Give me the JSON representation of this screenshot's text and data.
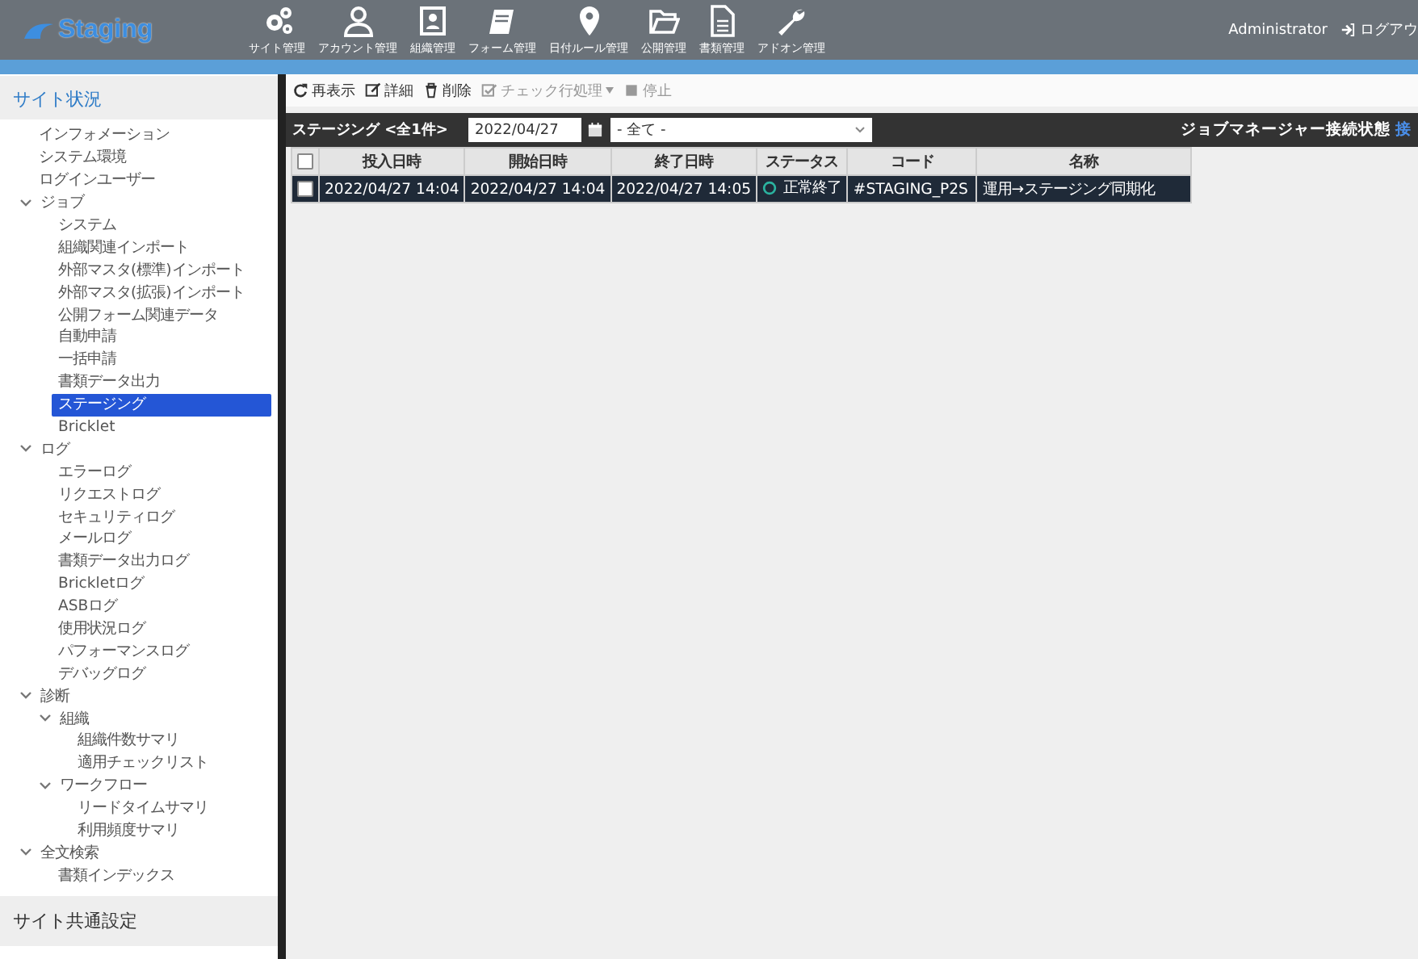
{
  "header": {
    "logo": "Staging",
    "nav": [
      {
        "label": "サイト管理"
      },
      {
        "label": "アカウント管理"
      },
      {
        "label": "組織管理"
      },
      {
        "label": "フォーム管理"
      },
      {
        "label": "日付ルール管理"
      },
      {
        "label": "公開管理"
      },
      {
        "label": "書類管理"
      },
      {
        "label": "アドオン管理"
      }
    ],
    "user": "Administrator",
    "logout": "ログアウ"
  },
  "sidebar": {
    "title": "サイト状況",
    "items": [
      {
        "label": "インフォメーション",
        "selected": false
      },
      {
        "label": "システム環境",
        "selected": false
      },
      {
        "label": "ログインユーザー",
        "selected": false
      },
      {
        "label": "ジョブ",
        "selected": false,
        "expanded": true,
        "children": [
          {
            "label": "システム",
            "selected": false
          },
          {
            "label": "組織関連インポート",
            "selected": false
          },
          {
            "label": "外部マスタ(標準)インポート",
            "selected": false
          },
          {
            "label": "外部マスタ(拡張)インポート",
            "selected": false
          },
          {
            "label": "公開フォーム関連データ",
            "selected": false
          },
          {
            "label": "自動申請",
            "selected": false
          },
          {
            "label": "一括申請",
            "selected": false
          },
          {
            "label": "書類データ出力",
            "selected": false
          },
          {
            "label": "ステージング",
            "selected": true
          },
          {
            "label": "Bricklet",
            "selected": false
          }
        ]
      },
      {
        "label": "ログ",
        "selected": false,
        "expanded": true,
        "children": [
          {
            "label": "エラーログ",
            "selected": false
          },
          {
            "label": "リクエストログ",
            "selected": false
          },
          {
            "label": "セキュリティログ",
            "selected": false
          },
          {
            "label": "メールログ",
            "selected": false
          },
          {
            "label": "書類データ出力ログ",
            "selected": false
          },
          {
            "label": "Brickletログ",
            "selected": false
          },
          {
            "label": "ASBログ",
            "selected": false
          },
          {
            "label": "使用状況ログ",
            "selected": false
          },
          {
            "label": "パフォーマンスログ",
            "selected": false
          },
          {
            "label": "デバッグログ",
            "selected": false
          }
        ]
      },
      {
        "label": "診断",
        "selected": false,
        "expanded": true,
        "children": [
          {
            "label": "組織",
            "selected": false,
            "expanded": true,
            "children": [
              {
                "label": "組織件数サマリ",
                "selected": false
              },
              {
                "label": "適用チェックリスト",
                "selected": false
              }
            ]
          },
          {
            "label": "ワークフロー",
            "selected": false,
            "expanded": true,
            "children": [
              {
                "label": "リードタイムサマリ",
                "selected": false
              },
              {
                "label": "利用頻度サマリ",
                "selected": false
              }
            ]
          }
        ]
      },
      {
        "label": "全文検索",
        "selected": false,
        "expanded": true,
        "children": [
          {
            "label": "書類インデックス",
            "selected": false
          }
        ]
      }
    ],
    "next_section": "サイト共通設定"
  },
  "toolbar": [
    {
      "label": "再表示",
      "disabled": false
    },
    {
      "label": "詳細",
      "disabled": false
    },
    {
      "label": "削除",
      "disabled": false
    },
    {
      "label": "チェック行処理",
      "disabled": true,
      "dropdown": true
    },
    {
      "label": "停止",
      "disabled": true
    }
  ],
  "panel": {
    "title": "ステージング <全1件>",
    "date": "2022/04/27",
    "filter": "- 全て -",
    "connection_label": "ジョブマネージャー接続状態",
    "connection_value": "接"
  },
  "table": {
    "all_checked": false,
    "columns": [
      "投入日時",
      "開始日時",
      "終了日時",
      "ステータス",
      "コード",
      "名称"
    ],
    "rows": [
      {
        "cells": [
          "2022/04/27 14:04",
          "2022/04/27 14:04",
          "2022/04/27 14:05",
          "正常終了",
          "#STAGING_P2S",
          "運用→ステージング同期化"
        ],
        "selected": true,
        "checked": false,
        "color": "#2bb3a0"
      }
    ]
  }
}
